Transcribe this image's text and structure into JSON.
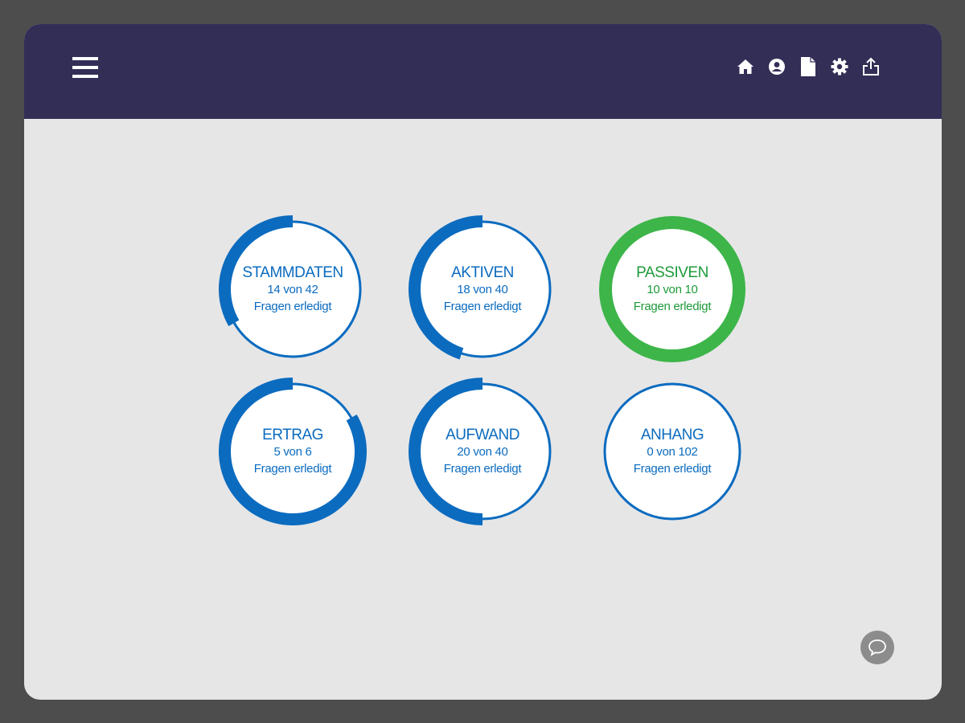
{
  "header": {
    "menu_icon": "hamburger-menu-icon",
    "icons": [
      "home-icon",
      "user-icon",
      "document-icon",
      "gear-icon",
      "share-icon"
    ]
  },
  "categories": [
    {
      "title": "STAMMDATEN",
      "count": "14 von 42",
      "sub": "Fragen erledigt",
      "done": 14,
      "total": 42,
      "status": "in-progress"
    },
    {
      "title": "AKTIVEN",
      "count": "18 von 40",
      "sub": "Fragen erledigt",
      "done": 18,
      "total": 40,
      "status": "in-progress"
    },
    {
      "title": "PASSIVEN",
      "count": "10 von 10",
      "sub": "Fragen erledigt",
      "done": 10,
      "total": 10,
      "status": "complete"
    },
    {
      "title": "ERTRAG",
      "count": "5 von 6",
      "sub": "Fragen erledigt",
      "done": 5,
      "total": 6,
      "status": "in-progress"
    },
    {
      "title": "AUFWAND",
      "count": "20 von 40",
      "sub": "Fragen erledigt",
      "done": 20,
      "total": 40,
      "status": "in-progress"
    },
    {
      "title": "ANHANG",
      "count": "0 von 102",
      "sub": "Fragen erledigt",
      "done": 0,
      "total": 102,
      "status": "not-started"
    }
  ],
  "colors": {
    "header_bg": "#332e56",
    "screen_bg": "#e6e6e7",
    "progress_blue": "#0b6bbf",
    "complete_green": "#3db549",
    "complete_text": "#1e9a3a",
    "chat_button": "#8c8c8c"
  },
  "chat": {
    "icon": "chat-bubble-icon"
  }
}
